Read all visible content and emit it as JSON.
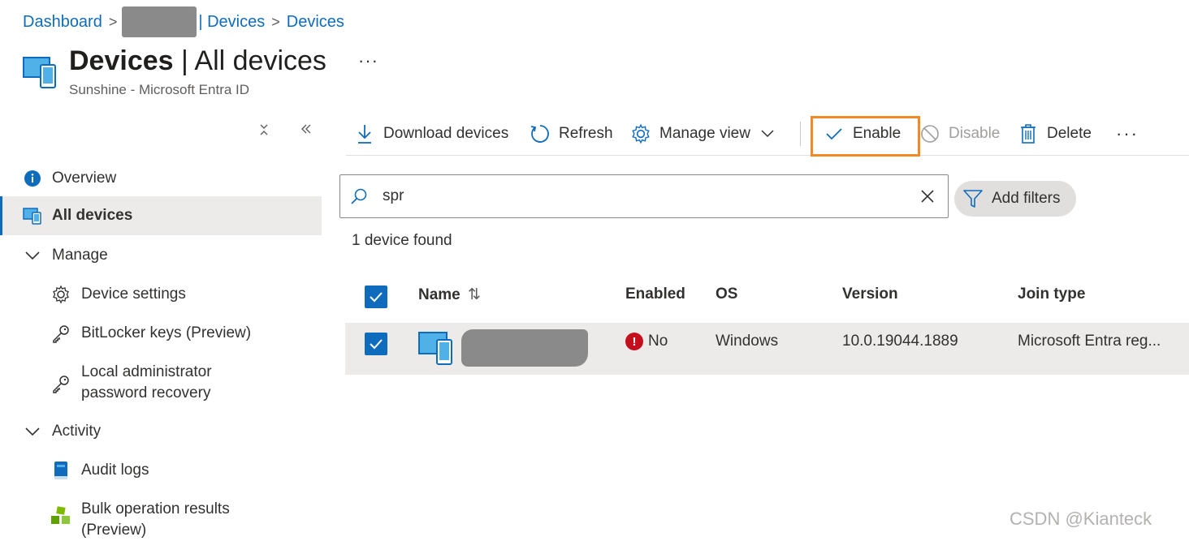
{
  "breadcrumb": {
    "item1": "Dashboard",
    "item2": "| Devices",
    "item3": "Devices"
  },
  "header": {
    "title_bold": "Devices",
    "title_rest": " | All devices",
    "more": "···",
    "subtitle": "Sunshine - Microsoft Entra ID"
  },
  "sidebar": {
    "overview": "Overview",
    "all_devices": "All devices",
    "manage": "Manage",
    "device_settings": "Device settings",
    "bitlocker": "BitLocker keys (Preview)",
    "local_admin_line1": "Local administrator",
    "local_admin_line2": "password recovery",
    "activity": "Activity",
    "audit_logs": "Audit logs",
    "bulk_line1": "Bulk operation results",
    "bulk_line2": "(Preview)"
  },
  "toolbar": {
    "download": "Download devices",
    "refresh": "Refresh",
    "manage_view": "Manage view",
    "enable": "Enable",
    "disable": "Disable",
    "delete": "Delete",
    "more": "···"
  },
  "search": {
    "value": "spr"
  },
  "filters": {
    "add_label": "Add filters"
  },
  "results": {
    "count_text": "1 device found"
  },
  "table": {
    "columns": {
      "name": "Name",
      "sort_icon": "⇅",
      "enabled": "Enabled",
      "os": "OS",
      "version": "Version",
      "join_type": "Join type"
    },
    "rows": [
      {
        "enabled": "No",
        "os": "Windows",
        "version": "10.0.19044.1889",
        "join_type": "Microsoft Entra reg..."
      }
    ]
  },
  "watermark": "CSDN @Kianteck",
  "colors": {
    "accent": "#0f6cbd",
    "highlight": "#f08a24",
    "error": "#c50f1f"
  }
}
